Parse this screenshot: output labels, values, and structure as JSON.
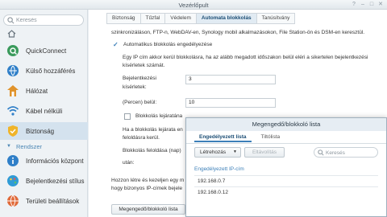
{
  "window": {
    "title": "Vezérlőpult"
  },
  "sidebar": {
    "search_placeholder": "Keresés",
    "items": [
      {
        "label": "QuickConnect",
        "icon": "quickconnect-icon"
      },
      {
        "label": "Külső hozzáférés",
        "icon": "external-access-icon"
      },
      {
        "label": "Hálózat",
        "icon": "network-icon"
      },
      {
        "label": "Kábel nélküli",
        "icon": "wifi-icon"
      },
      {
        "label": "Biztonság",
        "icon": "shield-icon",
        "active": true
      }
    ],
    "section_label": "Rendszer",
    "system_items": [
      {
        "label": "Információs központ",
        "icon": "info-icon"
      },
      {
        "label": "Bejelentkezési stílus",
        "icon": "palette-icon"
      },
      {
        "label": "Területi beállítások",
        "icon": "globe-icon"
      }
    ]
  },
  "tabs": [
    "Biztonság",
    "Tűzfal",
    "Védelem",
    "Automata blokkolás",
    "Tanúsítvány"
  ],
  "active_tab": "Automata blokkolás",
  "content": {
    "top_text": "szinkronizáláson, FTP-n, WebDAV-en, Synology mobil alkalmazásokon, File Station-ön és DSM-en keresztül.",
    "enable_label": "Automatikus blokkolás engedélyezése",
    "desc_line1": "Egy IP cím akkor kerül blokkolásra, ha az alább megadott időszakon belül eléri a sikertelen bejelentkezési",
    "desc_line2": "kísérletek számát.",
    "attempts_label_1": "Bejelentkezési",
    "attempts_label_2": "kísérletek:",
    "attempts_value": "3",
    "within_label": "(Percen) belül:",
    "within_value": "10",
    "expire_label": "Blokkolás lejáratána",
    "expire_desc_1": "Ha a blokkolás lejárata en",
    "expire_desc_2": "feloldásra kerül.",
    "expire_days_label": "Blokkolás feloldása (nap)",
    "expire_days_suffix": "után:",
    "bottom_text_1": "Hozzon létre és kezeljen egy m",
    "bottom_text_2": "hogy bizonyos IP-címek bejele",
    "allow_block_button": "Megengedő/blokkoló lista"
  },
  "dialog": {
    "title": "Megengedő/blokkoló lista",
    "tabs": [
      "Engedélyezett lista",
      "Tiltólista"
    ],
    "active_tab": "Engedélyezett lista",
    "create_button": "Létrehozás",
    "remove_button": "Eltávolítás",
    "search_placeholder": "Keresés",
    "column_header": "Engedélyezett IP-cím",
    "rows": [
      "192.168.0.7",
      "192.168.0.12"
    ]
  },
  "colors": {
    "accent": "#3c7fb8",
    "active_nav": "#d4e2ee"
  }
}
